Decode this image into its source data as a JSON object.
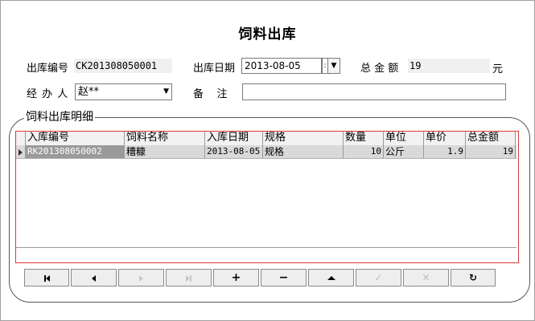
{
  "title": "饲料出库",
  "form": {
    "out_no_label": "出库编号",
    "out_no_value": "CK201308050001",
    "out_date_label": "出库日期",
    "out_date_value": "2013-08-05",
    "out_date_dropdown": ":",
    "total_label": "总 金 额",
    "total_value": "19",
    "currency": "元",
    "handler_label": "经 办 人",
    "handler_value": "赵**",
    "note_label": "备    注",
    "note_value": ""
  },
  "detail": {
    "group_title": "饲料出库明细",
    "columns": [
      "入库编号",
      "饲料名称",
      "入库日期",
      "规格",
      "数量",
      "单位",
      "单价",
      "总金额"
    ],
    "rows": [
      {
        "in_no": "RK201308050002",
        "name": "糟糠",
        "in_date": "2013-08-05",
        "spec": "规格",
        "qty": "10",
        "unit": "公斤",
        "price": "1.9",
        "total": "19"
      }
    ]
  },
  "toolbar": {
    "first": "first-record-icon",
    "prev": "previous-record-icon",
    "next": "next-record-icon",
    "last": "last-record-icon",
    "add": "add-icon",
    "delete": "delete-icon",
    "edit": "edit-icon",
    "post": "post-icon",
    "cancel": "cancel-icon",
    "refresh": "refresh-icon"
  }
}
